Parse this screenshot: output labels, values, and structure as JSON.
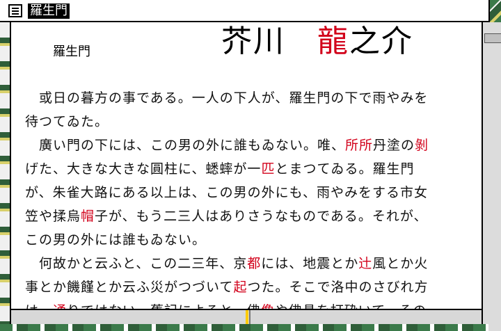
{
  "window": {
    "title": "羅生門"
  },
  "document": {
    "small_title": "羅生門",
    "author_part1": "芥川　",
    "author_red": "龍",
    "author_part2": "之介",
    "lines": [
      [
        {
          "t": "　或日の暮方の事である。一人の下人が、羅生門の下で雨やみを"
        }
      ],
      [
        {
          "t": "待つてゐた。"
        }
      ],
      [
        {
          "t": "　廣い門の下には、この男の外に誰もゐない。唯、"
        },
        {
          "t": "所所",
          "r": true
        },
        {
          "t": "丹塗の"
        },
        {
          "t": "剝",
          "r": true
        }
      ],
      [
        {
          "t": "げた、大きな大きな圓柱に、蟋蟀が一"
        },
        {
          "t": "匹",
          "r": true
        },
        {
          "t": "とまつてゐる。羅生門"
        }
      ],
      [
        {
          "t": "が、朱雀大路にある以上は、この男の外にも、雨やみをする市女"
        }
      ],
      [
        {
          "t": "笠や揉烏"
        },
        {
          "t": "帽",
          "r": true
        },
        {
          "t": "子が、もう二三人はありさうなものである。それが、"
        }
      ],
      [
        {
          "t": "この男の外には誰もゐない。"
        }
      ],
      [
        {
          "t": "　何故かと云ふと、この二三年、京"
        },
        {
          "t": "都",
          "r": true
        },
        {
          "t": "には、地震とか"
        },
        {
          "t": "辻",
          "r": true
        },
        {
          "t": "風とか火"
        }
      ],
      [
        {
          "t": "事とか饑饉とか云ふ災がつづいて"
        },
        {
          "t": "起",
          "r": true
        },
        {
          "t": "つた。そこで洛中のさびれ方"
        }
      ],
      [
        {
          "t": "は一"
        },
        {
          "t": "通",
          "r": true
        },
        {
          "t": "りではない。舊記によると、佛"
        },
        {
          "t": "像",
          "r": true
        },
        {
          "t": "や佛具を打砕いて、その"
        }
      ]
    ]
  },
  "colors": {
    "accent_red": "#d2001a",
    "text": "#111111",
    "window_bg": "#ffffff"
  },
  "icons": {
    "menu": "window-menu-icon"
  }
}
